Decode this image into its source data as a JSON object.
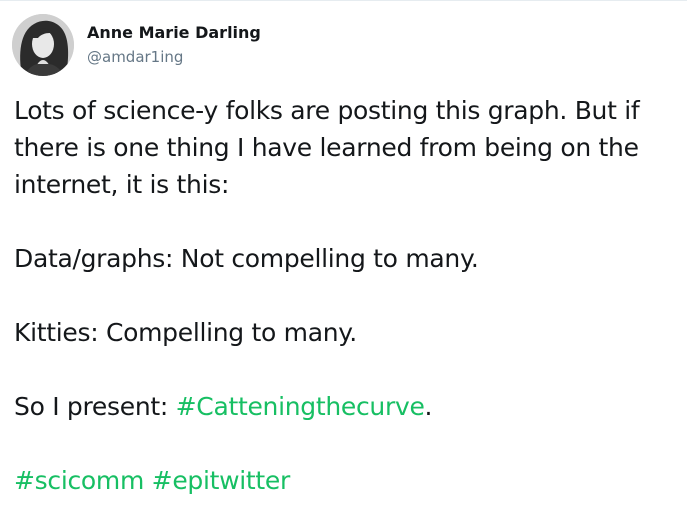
{
  "tweet": {
    "author": {
      "display_name": "Anne Marie Darling",
      "handle": "@amdar1ing",
      "avatar_icon": "profile-photo"
    },
    "paragraphs": {
      "p1": "Lots of science-y folks are posting this graph. But if there is one thing I have learned from being on the internet, it is this:",
      "p2": "Data/graphs: Not compelling to many.",
      "p3": "Kitties: Compelling to many.",
      "p4_prefix": "So I present: ",
      "p4_hashtag": "#Catteningthecurve",
      "p4_suffix": ".",
      "p5_hashtag1": "#scicomm",
      "p5_hashtag2": "#epitwitter"
    },
    "colors": {
      "hashtag": "#17bf63",
      "text": "#14171a",
      "handle": "#657786"
    }
  }
}
